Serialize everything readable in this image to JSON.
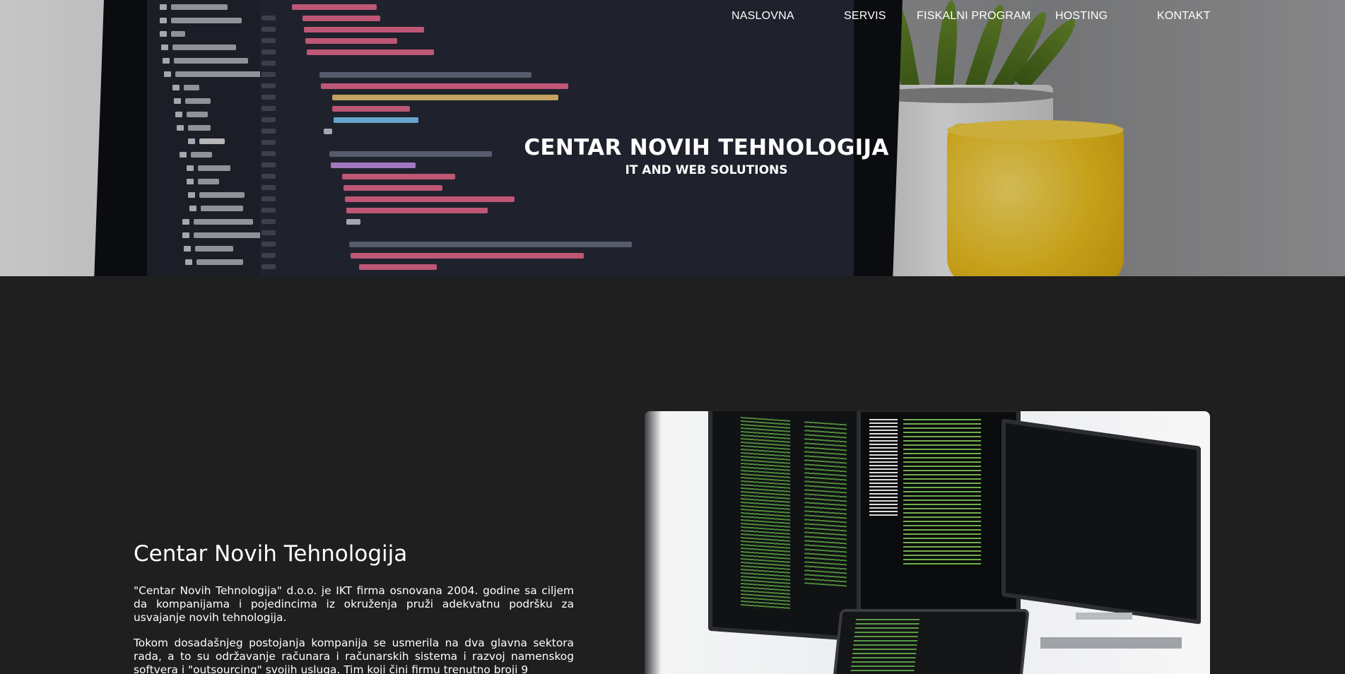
{
  "nav": {
    "items": [
      "NASLOVNA",
      "SERVIS",
      "FISKALNI PROGRAM",
      "HOSTING",
      "KONTAKT"
    ]
  },
  "hero": {
    "title": "CENTAR NOVIH TEHNOLOGIJA",
    "subtitle": "IT AND WEB SOLUTIONS"
  },
  "about": {
    "heading": "Centar Novih Tehnologija",
    "paragraph1": "\"Centar Novih Tehnologija\" d.o.o. je IKT firma osnovana 2004. godine sa ciljem da kompanijama i pojedincima iz okruženja pruži adekvatnu podršku za usvajanje novih tehnologija.",
    "paragraph2": "Tokom dosadašnjeg postojanja kompanija se usmerila na dva glavna sektora rada, a to su održavanje računara i računarskih sistema i razvoj namenskog softvera i \"outsourcing\" svojih usluga. Tim koji čini firmu trenutno broji 9"
  },
  "colors": {
    "background": "#1f1f20",
    "text": "#ffffff"
  }
}
